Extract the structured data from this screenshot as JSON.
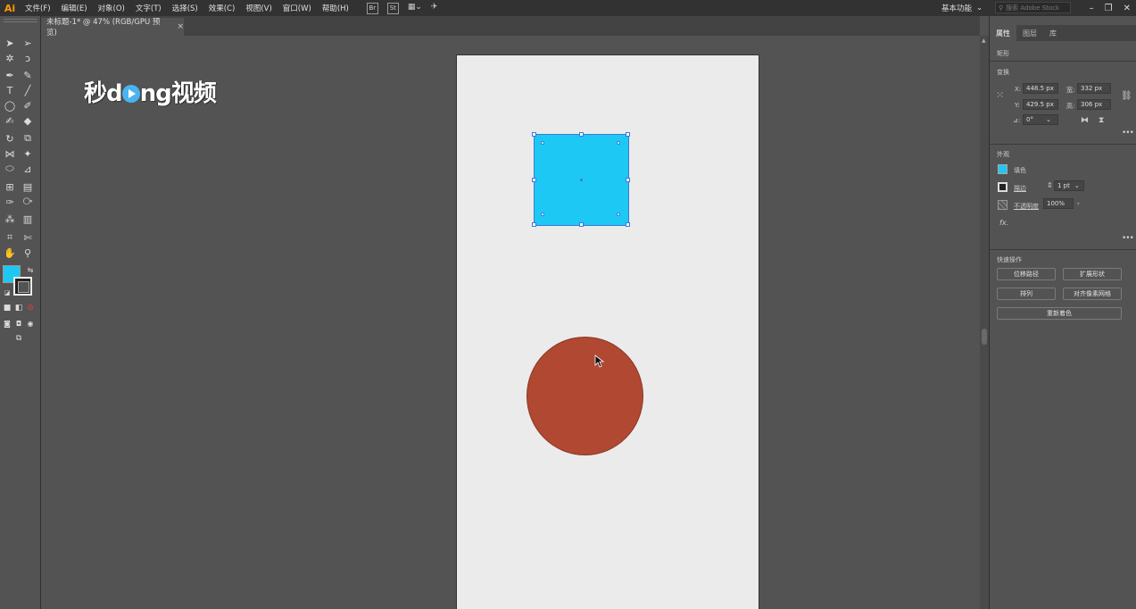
{
  "app": {
    "logo": "Ai",
    "workspace": "基本功能",
    "stock_search": "搜索 Adobe Stock"
  },
  "menu": [
    "文件(F)",
    "编辑(E)",
    "对象(O)",
    "文字(T)",
    "选择(S)",
    "效果(C)",
    "视图(V)",
    "窗口(W)",
    "帮助(H)"
  ],
  "menu_icons": {
    "bridge": "Br",
    "stock": "St"
  },
  "document_tab": {
    "title": "未标题-1* @ 47% (RGB/GPU 预览)",
    "close": "×"
  },
  "watermark": {
    "part1": "秒d",
    "part2": "ng视频"
  },
  "colors": {
    "fill": "#1ec8f5",
    "circle": "#b04832",
    "artboard": "#ebebeb",
    "selection": "#3a7bd5"
  },
  "panel": {
    "tabs": [
      "属性",
      "图层",
      "库"
    ],
    "object_type": "矩形",
    "transform_title": "变换",
    "x_label": "X:",
    "x_value": "448.5 px",
    "y_label": "Y:",
    "y_value": "429.5 px",
    "w_label": "宽:",
    "w_value": "332 px",
    "h_label": "高:",
    "h_value": "306 px",
    "angle_label": "⊿:",
    "angle_value": "0°",
    "appearance_title": "外观",
    "fill_label": "填色",
    "stroke_label": "描边",
    "stroke_value": "1 pt",
    "opacity_label": "不透明度",
    "opacity_value": "100%",
    "fx_label": "fx.",
    "quick_actions_title": "快速操作",
    "btn_offset_path": "位移路径",
    "btn_expand_shape": "扩展形状",
    "btn_arrange": "排列",
    "btn_align_pixel": "对齐像素网格",
    "btn_recolor": "重新着色"
  }
}
